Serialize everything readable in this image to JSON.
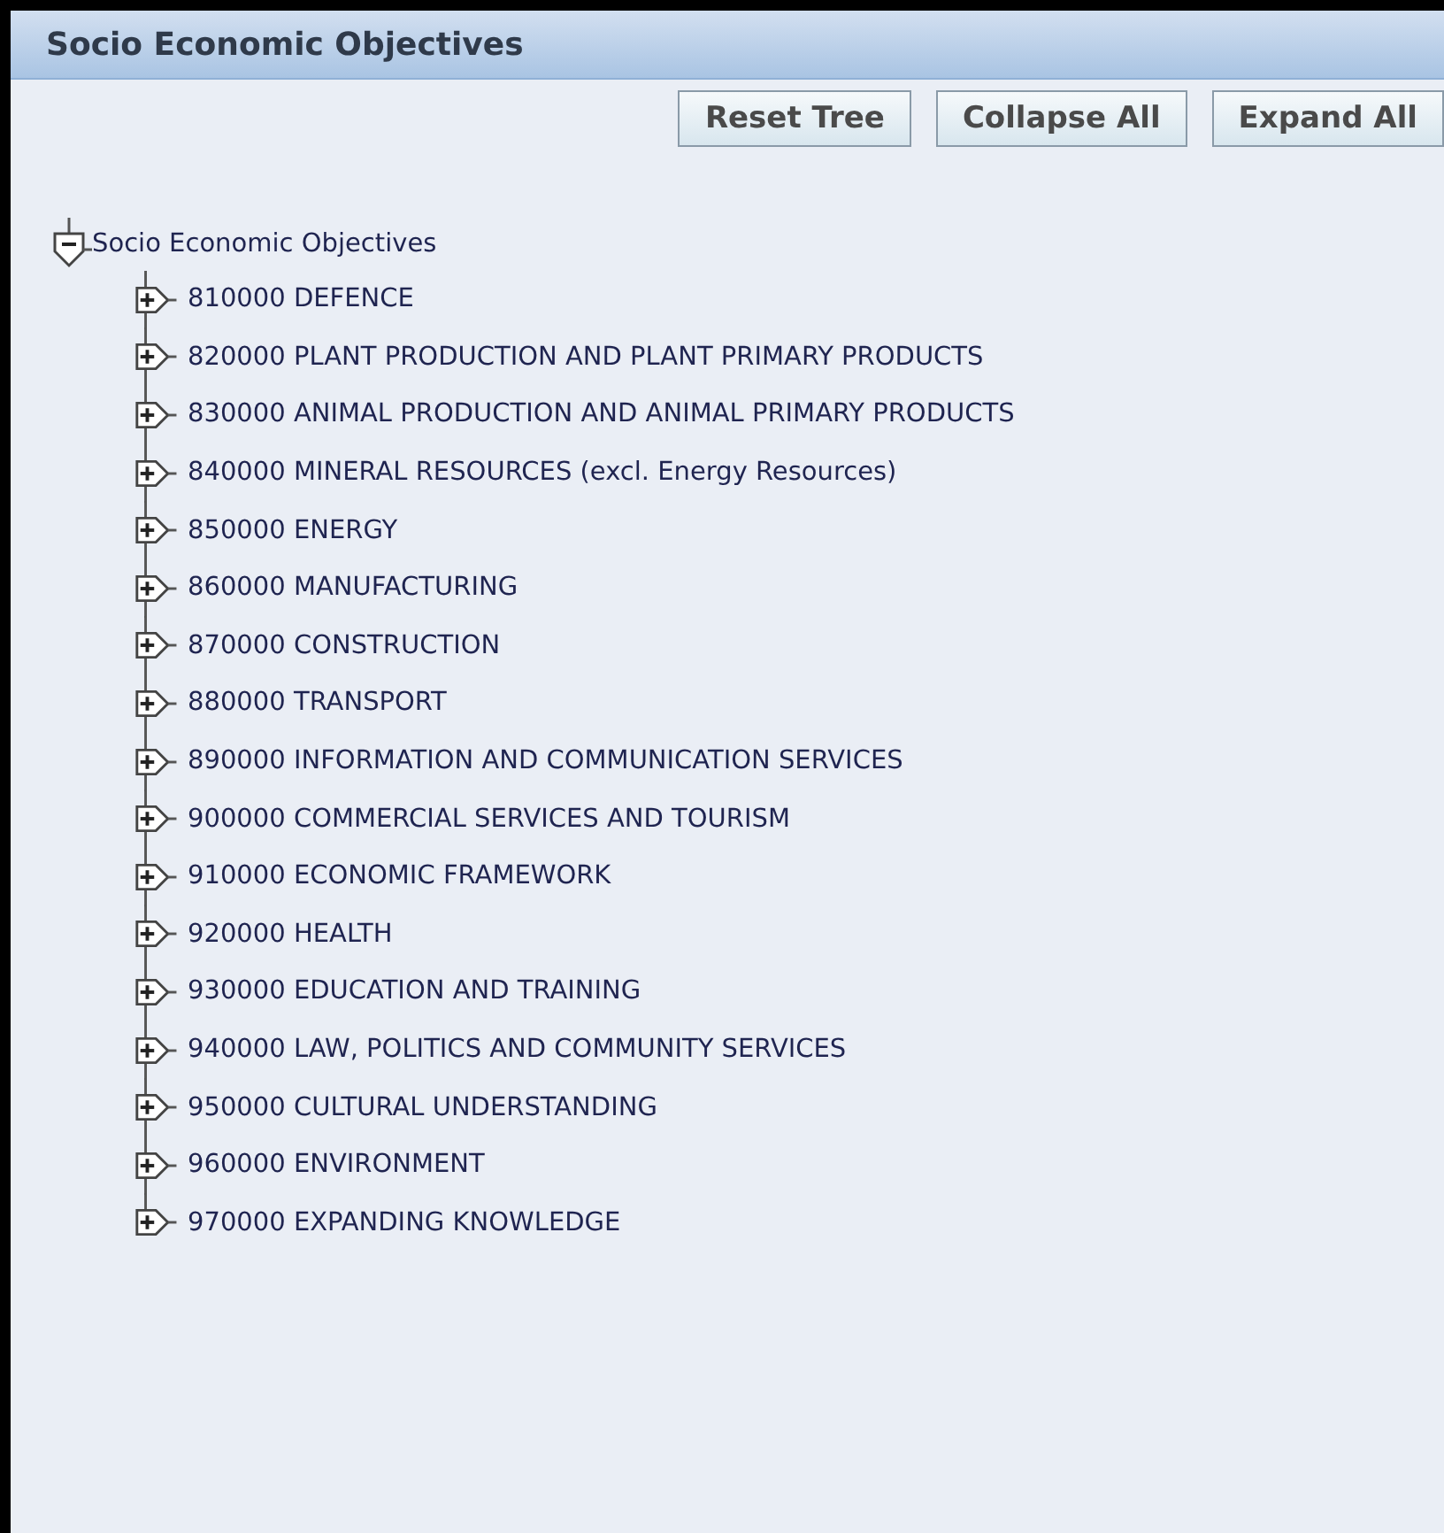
{
  "header": {
    "title": "Socio Economic Objectives"
  },
  "buttons": [
    "Reset Tree",
    "Collapse All",
    "Expand All"
  ],
  "tree": [
    {
      "label": "Socio Economic Objectives",
      "expanded": true,
      "children": [
        {
          "label": "810000 DEFENCE",
          "expanded": false
        },
        {
          "label": "820000 PLANT PRODUCTION AND PLANT PRIMARY PRODUCTS",
          "expanded": false
        },
        {
          "label": "830000 ANIMAL PRODUCTION AND ANIMAL PRIMARY PRODUCTS",
          "expanded": false
        },
        {
          "label": "840000 MINERAL RESOURCES (excl. Energy Resources)",
          "expanded": false
        },
        {
          "label": "850000 ENERGY",
          "expanded": false
        },
        {
          "label": "860000 MANUFACTURING",
          "expanded": false
        },
        {
          "label": "870000 CONSTRUCTION",
          "expanded": false
        },
        {
          "label": "880000 TRANSPORT",
          "expanded": false
        },
        {
          "label": "890000 INFORMATION AND COMMUNICATION SERVICES",
          "expanded": false
        },
        {
          "label": "900000 COMMERCIAL SERVICES AND TOURISM",
          "expanded": false
        },
        {
          "label": "910000 ECONOMIC FRAMEWORK",
          "expanded": false
        },
        {
          "label": "920000 HEALTH",
          "expanded": false
        },
        {
          "label": "930000 EDUCATION AND TRAINING",
          "expanded": false
        },
        {
          "label": "940000 LAW, POLITICS AND COMMUNITY SERVICES",
          "expanded": false
        },
        {
          "label": "950000 CULTURAL UNDERSTANDING",
          "expanded": false
        },
        {
          "label": "960000 ENVIRONMENT",
          "expanded": false
        },
        {
          "label": "970000 EXPANDING KNOWLEDGE",
          "expanded": false
        }
      ]
    }
  ]
}
